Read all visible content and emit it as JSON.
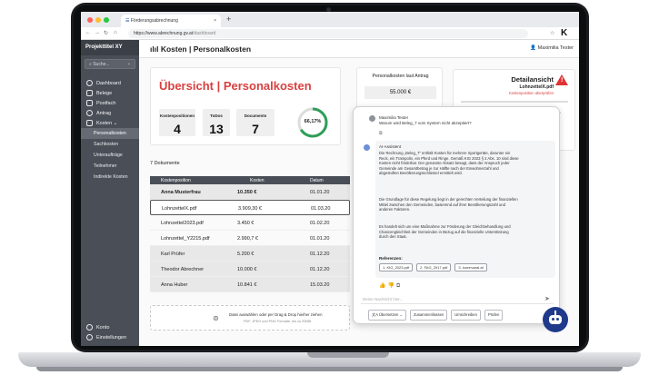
{
  "browser": {
    "tab_title": "Förderungsabrechnung",
    "url_host": "https://www.abrechnung.gv.at",
    "url_path": "/dashboard",
    "new_tab": "+",
    "tab_close": "×",
    "profile_letter": "K"
  },
  "sidebar": {
    "project": "Projekttitel XY",
    "search_placeholder": "Suche...",
    "items": [
      {
        "label": "Dashboard"
      },
      {
        "label": "Belege"
      },
      {
        "label": "Postfach"
      },
      {
        "label": "Antrag"
      },
      {
        "label": "Kosten ⌄"
      }
    ],
    "subitems": [
      {
        "label": "Personalkosten"
      },
      {
        "label": "Sachkosten"
      },
      {
        "label": "Unteraufträge"
      },
      {
        "label": "Teilnehmer"
      },
      {
        "label": "Indirekte Kosten"
      }
    ],
    "bottom": [
      {
        "label": "Konto"
      },
      {
        "label": "Einstellungen"
      }
    ]
  },
  "header": {
    "title": "Kosten | Personalkosten",
    "user": "Maximilia Tester"
  },
  "overview": {
    "title": "Übersicht | Personalkosten",
    "kpis": [
      {
        "label": "Kostenpositionen",
        "value": "4"
      },
      {
        "label": "ToDos",
        "value": "13"
      },
      {
        "label": "Documents",
        "value": "7"
      }
    ],
    "progress_label": "66,17%",
    "progress_value": 66.17
  },
  "antrag": {
    "label": "Personalkosten laut Antrag",
    "value": "55.000 €"
  },
  "detail": {
    "title": "Detailansicht",
    "file": "LohnzettelX.pdf",
    "status": "Kostenposition überprüfen",
    "warn": "!"
  },
  "documents": {
    "count_label": "7 Dokumente",
    "headers": [
      "Kostenposition",
      "Kosten",
      "Datum"
    ],
    "rows": [
      {
        "name": "Anna Musterfrau",
        "cost": "10.350 €",
        "date": "01.01.20"
      },
      {
        "name": "LohnzettelX.pdf",
        "cost": "3.909,30 €",
        "date": "01.03.20"
      },
      {
        "name": "Lohnzettel2023.pdf",
        "cost": "3.450 €",
        "date": "01.02.20"
      },
      {
        "name": "Lohnzettel_Y2215.pdf",
        "cost": "2.990,7 €",
        "date": "01.01.20"
      },
      {
        "name": "Karl Prüfer",
        "cost": "5.200 €",
        "date": "01.12.20"
      },
      {
        "name": "Theodor Abrechner",
        "cost": "10.000 €",
        "date": "01.12.20"
      },
      {
        "name": "Anna Huber",
        "cost": "10.841 €",
        "date": "15.03.20"
      }
    ],
    "drop_text": "Datei auswählen oder per Drag & Drop hierher ziehen",
    "drop_hint": "PDF, JPEG und PNG Formate, bis zu 20MB"
  },
  "chat": {
    "user_name": "Maximilia Tester",
    "user_message": "Warum wird Beleg_7 vom System nicht akzeptiert?",
    "ai_name": "AI-Assistent",
    "ai_p1": "Die Rechnung „Beleg_7“ enthält Kosten für mehrere Sportgeräte, darunter ein Reck, ein Trampolin, ein Pferd und Ringe. Gemäß KIG 2023 § 2 Abs. 10 sind diese Kosten nicht förderbar. Der genannte Absatz besagt, dass der Anspruch jeder Gemeinde am Gesamtbetrag je zur Hälfte nach der Einwohnerzahl und abgestuften Bevölkerungsschlüssel ermittelt wird.",
    "ai_p2": "Die Grundlage für diese Regelung liegt in der gerechten Verteilung der finanziellen Mittel zwischen den Gemeinden, basierend auf ihrer Bevölkerungszahl und anderen Faktoren.",
    "ai_p3": "Es handelt sich um eine Maßnahme zur Förderung der Gleichbehandlung und Chancengleichheit der Gemeinden in Bezug auf die finanzielle Unterstützung durch den Staat.",
    "refs_label": "Referenzen:",
    "refs": [
      "1. KIG_2023.pdf",
      "2. FAG_2017.pdf",
      "3. kommunal.at"
    ],
    "input_placeholder": "Deine Nachricht hier...",
    "actions": [
      "文A Übersetzen ⌄",
      "Zusammenfassen",
      "Umschreiben",
      "Prüfen"
    ]
  }
}
